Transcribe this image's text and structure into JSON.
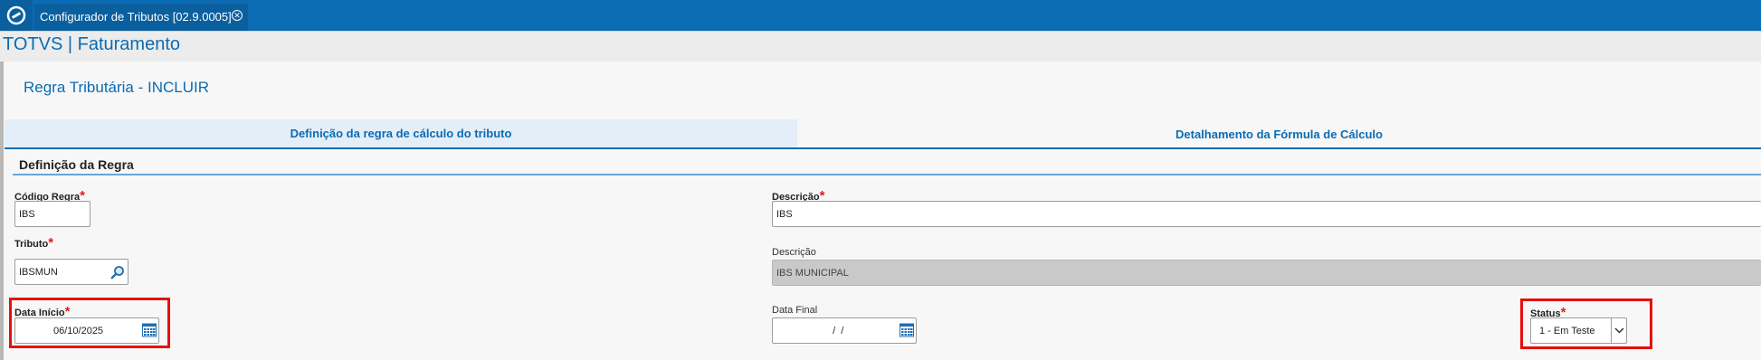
{
  "window": {
    "tab_title": "Configurador de Tributos [02.9.0005]"
  },
  "app": {
    "title": "TOTVS | Faturamento"
  },
  "page": {
    "title": "Regra Tributária - INCLUIR"
  },
  "tabs": [
    {
      "label": "Definição da regra de cálculo do tributo"
    },
    {
      "label": "Detalhamento da Fórmula de Cálculo"
    }
  ],
  "section": {
    "title": "Definição da Regra"
  },
  "required_mark": "*",
  "fields": {
    "codigo_regra": {
      "label": "Código Regra",
      "value": "IBS"
    },
    "descricao": {
      "label": "Descrição",
      "value": "IBS"
    },
    "tributo": {
      "label": "Tributo",
      "value": "IBSMUN"
    },
    "descricao_tributo": {
      "label": "Descrição",
      "value": "IBS MUNICIPAL"
    },
    "data_inicio": {
      "label": "Data Início",
      "value": "06/10/2025"
    },
    "data_final": {
      "label": "Data Final",
      "value": "  /  /"
    },
    "status": {
      "label": "Status",
      "value": "1 - Em Teste"
    }
  },
  "colors": {
    "brand": "#0b6cb3",
    "highlight": "#e60f0f",
    "required": "#e21d1d"
  },
  "icons": [
    "totvs-logo-icon",
    "close-tab-icon",
    "search-icon",
    "calendar-icon",
    "chevron-down-icon"
  ]
}
